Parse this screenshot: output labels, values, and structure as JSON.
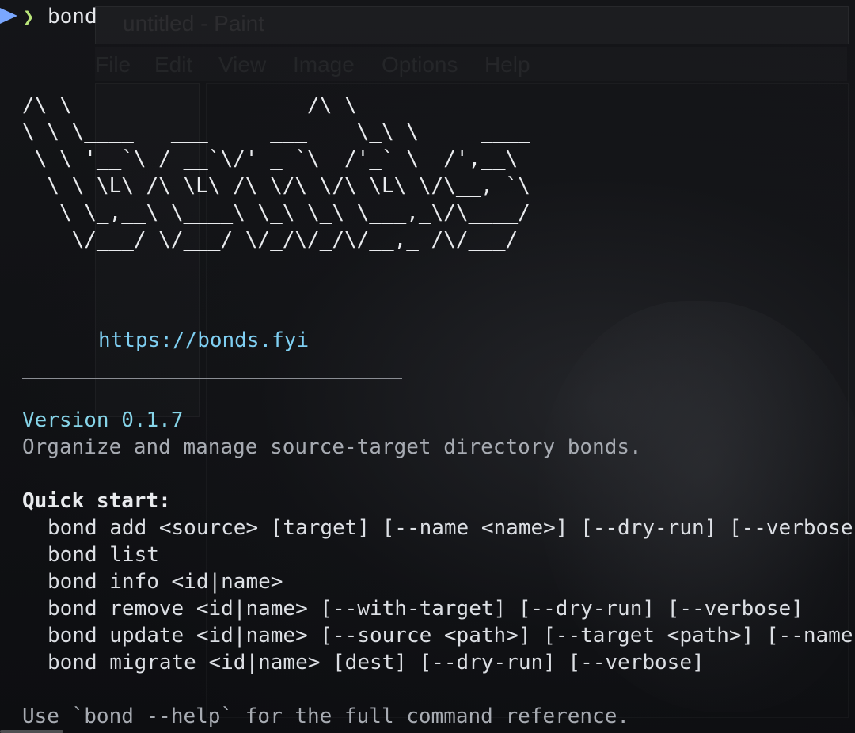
{
  "prompt": {
    "command": "bond"
  },
  "background_window": {
    "title": "untitled - Paint",
    "menu": [
      "File",
      "Edit",
      "View",
      "Image",
      "Options",
      "Help"
    ]
  },
  "banner": {
    "ascii_art": " __                     __\n/\\ \\                   /\\ \\\n\\ \\ \\____   ___     ___    \\_\\ \\     ____\n \\ \\ '__`\\ / __`\\/' _ `\\  /'_` \\  /',__\\\n  \\ \\ \\L\\ /\\ \\L\\ /\\ \\/\\ \\/\\ \\L\\ \\/\\__, `\\\n   \\ \\_,__\\ \\____\\ \\_\\ \\_\\ \\___,_\\/\\____/\n    \\/___/ \\/___/ \\/_/\\/_/\\/__,_ /\\/___/",
    "url": "https://bonds.fyi"
  },
  "info": {
    "version": "Version 0.1.7",
    "description": "Organize and manage source-target directory bonds."
  },
  "quick_start": {
    "title": "Quick start:",
    "commands": [
      "bond add <source> [target] [--name <name>] [--dry-run] [--verbose]",
      "bond list",
      "bond info <id|name>",
      "bond remove <id|name> [--with-target] [--dry-run] [--verbose]",
      "bond update <id|name> [--source <path>] [--target <path>] [--name <name>]",
      "bond migrate <id|name> [dest] [--dry-run] [--verbose]"
    ]
  },
  "footer": "Use `bond --help` for the full command reference.",
  "colors": {
    "background": "#0f1013",
    "prompt_marker": "#7aa7ff",
    "prompt_chevron": "#b9e57a",
    "url": "#7fcff2",
    "version": "#86d4e8",
    "muted_text": "#a7abb2",
    "text": "#dcdfe4"
  }
}
